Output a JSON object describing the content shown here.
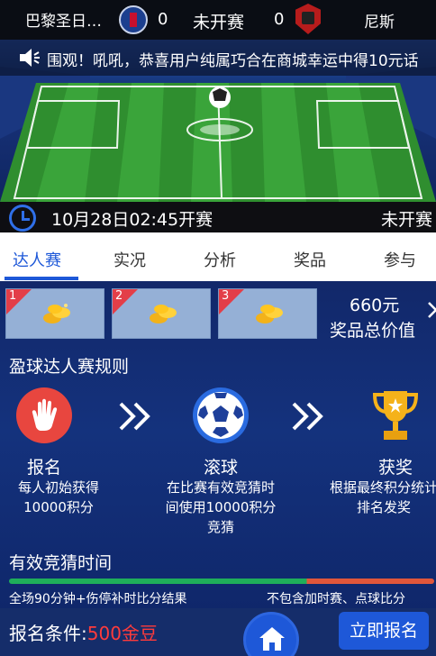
{
  "match": {
    "home_team": "巴黎圣日…",
    "home_score": "0",
    "status": "未开赛",
    "away_score": "0",
    "away_team": "尼斯",
    "time": "10月28日02:45开赛",
    "status_bottom": "未开赛"
  },
  "marquee": {
    "text": "围观！吼吼，恭喜用户纯属巧合在商城幸运中得10元话"
  },
  "tabs": [
    {
      "label": "达人赛",
      "active": true
    },
    {
      "label": "实况"
    },
    {
      "label": "分析"
    },
    {
      "label": "奖品"
    },
    {
      "label": "参与"
    }
  ],
  "prizes": {
    "ranks": [
      "1",
      "2",
      "3"
    ],
    "total_amount": "660元",
    "total_label": "奖品总价值"
  },
  "rules": {
    "title": "盈球达人赛规则",
    "steps": [
      {
        "title": "报名",
        "desc_lines": [
          "每人初始获得",
          "10000积分"
        ],
        "icon": "hand-icon"
      },
      {
        "title": "滚球",
        "desc_lines": [
          "在比赛有效竞猜时",
          "间使用10000积分",
          "竞猜"
        ],
        "icon": "soccer-ball-icon"
      },
      {
        "title": "获奖",
        "desc_lines": [
          "根据最终积分统计",
          "排名发奖"
        ],
        "icon": "trophy-icon"
      }
    ]
  },
  "valid_time": {
    "title": "有效竞猜时间",
    "left_text": "全场90分钟+伤停补时比分结果",
    "right_text": "不包含加时赛、点球比分"
  },
  "footer": {
    "condition_label": "报名条件:",
    "condition_cost": "500金豆",
    "register_label": "立即报名"
  },
  "colors": {
    "accent": "#1e58d8",
    "rank_flag": "#e33e48",
    "cost": "#ff3b3b"
  }
}
